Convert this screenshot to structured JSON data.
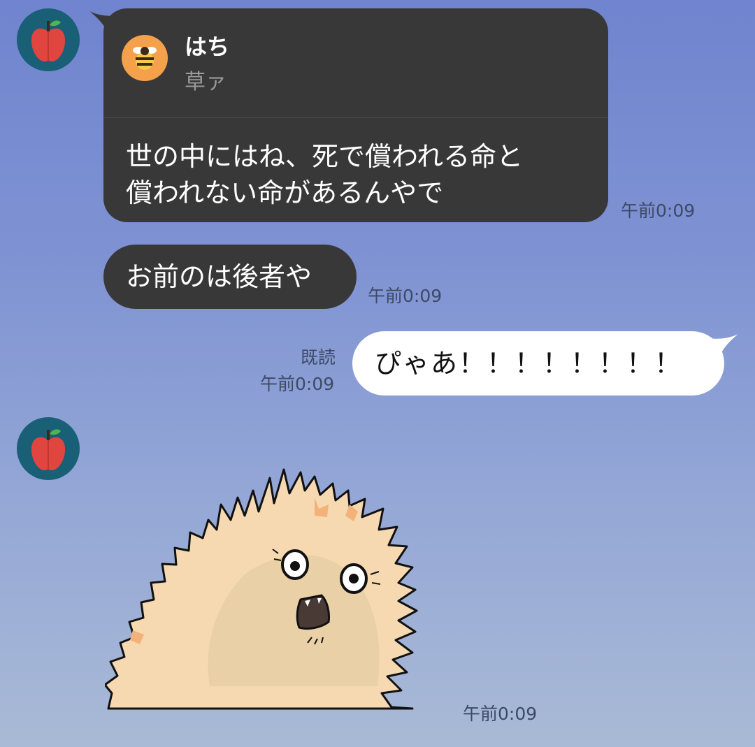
{
  "colors": {
    "background_top": "#7084cf",
    "background_bottom": "#a9bad6",
    "bubble_other": "#383838",
    "bubble_self": "#ffffff",
    "timestamp_text": "#3d4a66"
  },
  "messages": [
    {
      "sender": "other",
      "avatar_icon": "apple-icon",
      "reply_to": {
        "icon": "bee-icon",
        "name": "はち",
        "quote": "草ァ"
      },
      "text_line1": "世の中にはね、死で償われる命と",
      "text_line2": "償われない命があるんやで",
      "time": "午前0:09"
    },
    {
      "sender": "other",
      "text": "お前のは後者や",
      "time": "午前0:09"
    },
    {
      "sender": "self",
      "read_label": "既読",
      "text": "ぴゃあ！！！！！！！！",
      "time": "午前0:09"
    },
    {
      "sender": "other",
      "avatar_icon": "apple-icon",
      "sticker": "shocked-fluffy-creature-sticker",
      "time": "午前0:09"
    }
  ]
}
